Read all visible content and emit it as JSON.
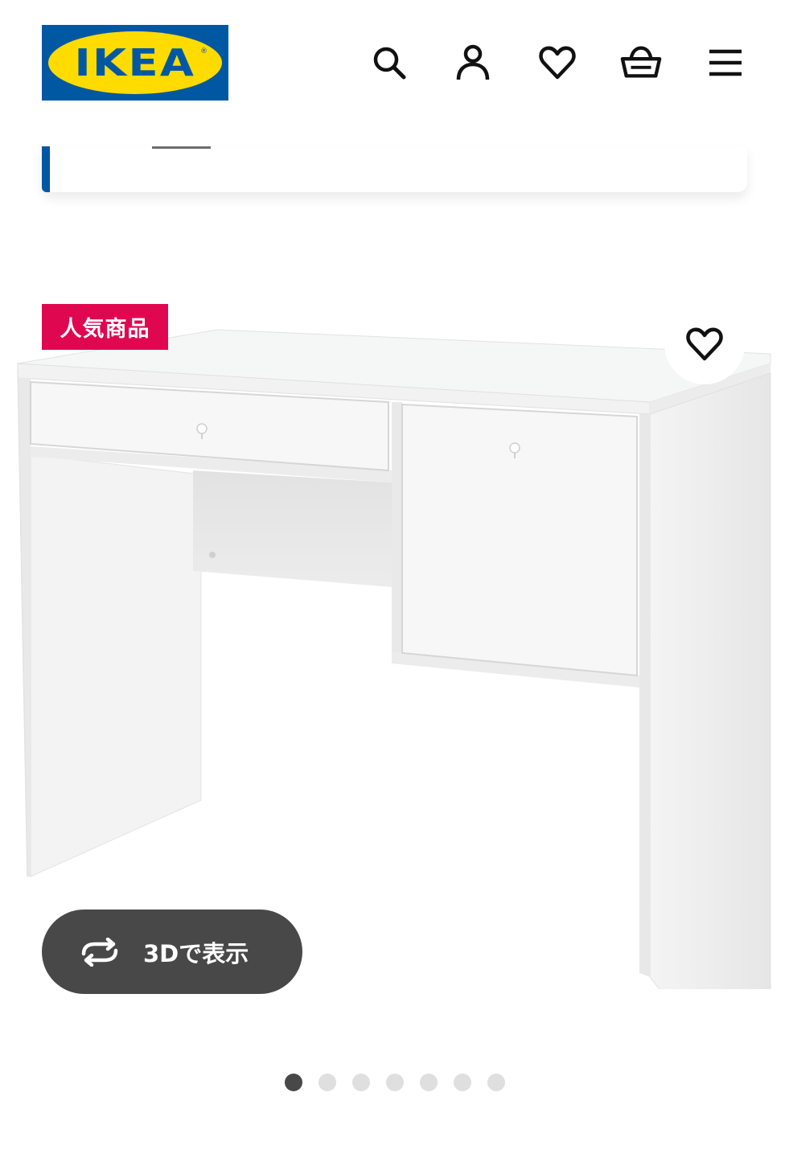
{
  "brand": {
    "logo_text": "IKEA",
    "logo_reg": "®",
    "blue": "#0058a3",
    "yellow": "#ffdb00"
  },
  "header": {
    "icons": [
      "search-icon",
      "account-icon",
      "favorites-heart-icon",
      "shopping-basket-icon",
      "hamburger-menu-icon"
    ]
  },
  "product": {
    "badge": "人気商品",
    "badge_color": "#e00751",
    "view_3d_label": "3Dで表示",
    "favorite_icon": "heart-icon"
  },
  "gallery": {
    "total_images": 7,
    "active_index": 0
  }
}
